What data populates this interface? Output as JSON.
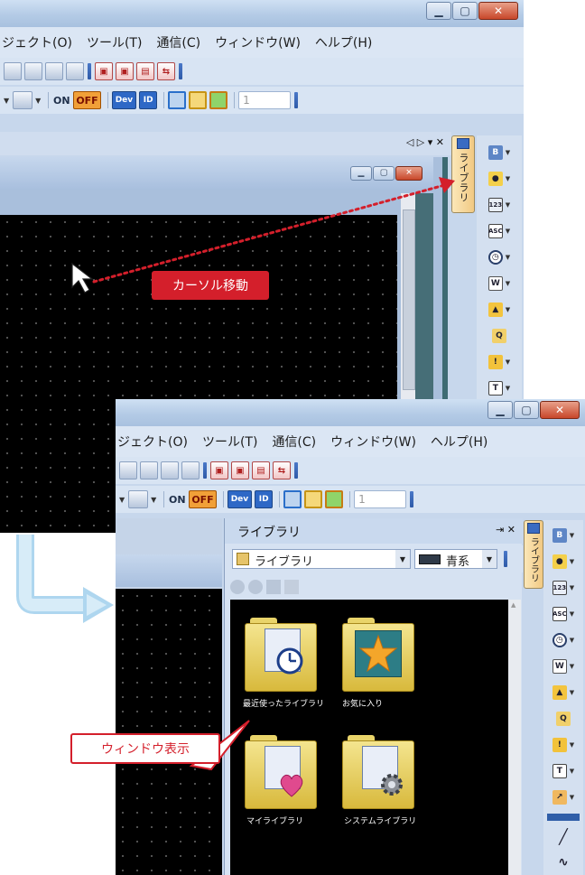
{
  "window_top": {
    "menu": [
      "ジェクト(O)",
      "ツール(T)",
      "通信(C)",
      "ウィンドウ(W)",
      "ヘルプ(H)"
    ],
    "toolbar_on": "ON",
    "toolbar_off": "OFF",
    "toolbar_dev": "Dev",
    "toolbar_id": "ID",
    "number_value": "1",
    "pane_controls": "◁ ▷ ▾ ✕",
    "library_tab": "ライブラリ"
  },
  "callouts": {
    "cursor_move": "カーソル移動",
    "window_display": "ウィンドウ表示"
  },
  "window_bottom": {
    "menu": [
      "ジェクト(O)",
      "ツール(T)",
      "通信(C)",
      "ウィンドウ(W)",
      "ヘルプ(H)"
    ],
    "toolbar_on": "ON",
    "toolbar_off": "OFF",
    "toolbar_dev": "Dev",
    "toolbar_id": "ID",
    "number_value": "1",
    "library_panel": {
      "title": "ライブラリ",
      "pin": "⇥ ✕",
      "category_select": "ライブラリ",
      "color_select": "青系",
      "items": [
        {
          "label": "最近使ったライブラリ"
        },
        {
          "label": "お気に入り"
        },
        {
          "label": "マイライブラリ"
        },
        {
          "label": "システムライブラリ"
        }
      ]
    },
    "library_tab": "ライブラリ"
  },
  "icons": {
    "right_toolbar": [
      "library-bitmap-icon",
      "bulb-icon",
      "numeric-icon",
      "ascii-icon",
      "clock-icon",
      "comment-icon",
      "alarm-list-icon",
      "search-alarm-icon",
      "alarm-icon",
      "item-list-icon",
      "chart-icon"
    ],
    "draw_tools": [
      "line-icon",
      "polyline-icon",
      "rectangle-icon"
    ]
  },
  "colors": {
    "accent_red": "#d41f2b",
    "titlebar": "#b4cbe6",
    "menubar": "#dbe6f4",
    "canvas": "#000000",
    "folder": "#f4e58f"
  }
}
